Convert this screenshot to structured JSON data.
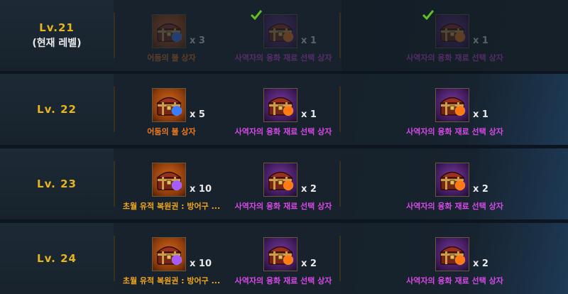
{
  "rows": [
    {
      "level": "Lv.21",
      "sub": "(현재 레벨)",
      "claimed": true,
      "rewards": [
        {
          "name": "어둠의 불 상자",
          "qty": "x 3",
          "color": "orange",
          "icon": "chest-fire-icon"
        },
        {
          "name": "사역자의 융화 재료 선택 상자",
          "qty": "x 1",
          "color": "purple",
          "icon": "chest-fusion-icon"
        },
        {
          "name": "사역자의 융화 재료 선택 상자",
          "qty": "x 1",
          "color": "purple",
          "icon": "chest-fusion-icon"
        }
      ]
    },
    {
      "level": "Lv. 22",
      "claimed": false,
      "rewards": [
        {
          "name": "어둠의 불 상자",
          "qty": "x 5",
          "color": "orange",
          "icon": "chest-fire-icon"
        },
        {
          "name": "사역자의 융화 재료 선택 상자",
          "qty": "x 1",
          "color": "purple",
          "icon": "chest-fusion-icon"
        },
        {
          "name": "사역자의 융화 재료 선택 상자",
          "qty": "x 1",
          "color": "purple",
          "icon": "chest-fusion-icon"
        }
      ]
    },
    {
      "level": "Lv. 23",
      "claimed": false,
      "rewards": [
        {
          "name": "초월 유적 복원권 : 방어구 ...",
          "qty": "x 10",
          "color": "gold",
          "icon": "chest-relic-icon"
        },
        {
          "name": "사역자의 융화 재료 선택 상자",
          "qty": "x 2",
          "color": "purple",
          "icon": "chest-fusion-icon"
        },
        {
          "name": "사역자의 융화 재료 선택 상자",
          "qty": "x 2",
          "color": "purple",
          "icon": "chest-fusion-icon"
        }
      ]
    },
    {
      "level": "Lv. 24",
      "claimed": false,
      "rewards": [
        {
          "name": "초월 유적 복원권 : 방어구 ...",
          "qty": "x 10",
          "color": "gold",
          "icon": "chest-relic-icon"
        },
        {
          "name": "사역자의 융화 재료 선택 상자",
          "qty": "x 2",
          "color": "purple",
          "icon": "chest-fusion-icon"
        },
        {
          "name": "사역자의 융화 재료 선택 상자",
          "qty": "x 2",
          "color": "purple",
          "icon": "chest-fusion-icon"
        }
      ]
    }
  ],
  "colors": {
    "level_text": "#e8b51e",
    "orange_name": "#f07a20",
    "gold_name": "#f2a71c",
    "purple_name": "#d649e6",
    "check": "#5fbf24"
  }
}
